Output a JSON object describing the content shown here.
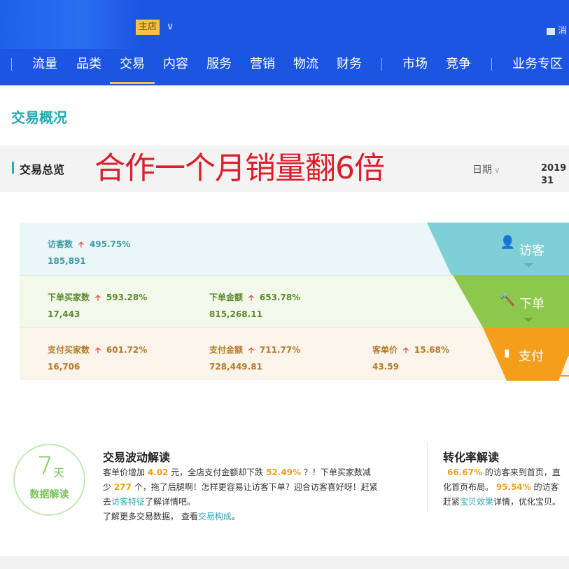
{
  "header": {
    "store_badge": "主店",
    "store_chevron": "∨",
    "message_label": "消"
  },
  "nav": {
    "items": [
      "流量",
      "品类",
      "交易",
      "内容",
      "服务",
      "营销",
      "物流",
      "财务",
      "市场",
      "竞争",
      "业务专区"
    ],
    "active_index": 2
  },
  "page_title": "交易概况",
  "overview": {
    "label": "交易总览",
    "promo_text": "合作一个月销量翻6倍",
    "date_label": "日期",
    "date_value_line1": "2019",
    "date_value_line2": "31"
  },
  "funnel": {
    "visit": {
      "stage": "访客",
      "metrics": [
        {
          "name": "访客数",
          "change": "495.75%",
          "value": "185,891"
        }
      ]
    },
    "order": {
      "stage": "下单",
      "metrics": [
        {
          "name": "下单买家数",
          "change": "593.28%",
          "value": "17,443"
        },
        {
          "name": "下单金额",
          "change": "653.78%",
          "value": "815,268.11"
        }
      ]
    },
    "pay": {
      "stage": "支付",
      "metrics": [
        {
          "name": "支付买家数",
          "change": "601.72%",
          "value": "16,706"
        },
        {
          "name": "支付金额",
          "change": "711.77%",
          "value": "728,449.81"
        },
        {
          "name": "客单价",
          "change": "15.68%",
          "value": "43.59"
        }
      ]
    },
    "colors": {
      "visit": "#7fd0d6",
      "order": "#8cc84b",
      "pay": "#f59e1c"
    }
  },
  "badge": {
    "number": "7",
    "unit": "天",
    "label": "数据解读"
  },
  "trade_card": {
    "title": "交易波动解读",
    "l1_a": "客单价增加 ",
    "l1_v1": "4.02",
    "l1_b": " 元，全店支付金额却下跌 ",
    "l1_v2": "52.49%",
    "l1_c": " ？！下单买家数减",
    "l2_a": "少 ",
    "l2_v": "277",
    "l2_b": " 个，拖了后腿啊！怎样更容易让访客下单？迎合访客喜好呀！赶紧",
    "l3_a": "去",
    "l3_link": "访客特征",
    "l3_b": "了解详情吧。",
    "l4_a": "了解更多交易数据，  查看",
    "l4_link": "交易构成",
    "l4_b": "。"
  },
  "conv_card": {
    "title": "转化率解读",
    "l1_v": "66.67%",
    "l1_a": " 的访客来到首页，直",
    "l2_a": "化首页布局。 ",
    "l2_v": "95.54%",
    "l2_b": " 的访客",
    "l3_a": "赶紧",
    "l3_link": "宝贝效果",
    "l3_b": "详情，优化宝贝。"
  }
}
